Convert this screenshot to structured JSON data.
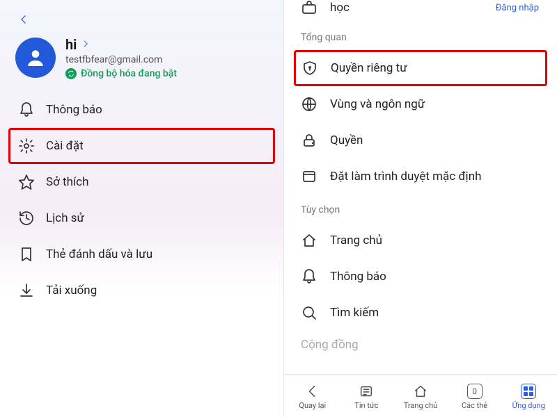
{
  "left": {
    "profile": {
      "name": "hi",
      "email": "testfbfear@gmail.com",
      "sync_status": "Đồng bộ hóa đang bật"
    },
    "menu": [
      {
        "label": "Thông báo",
        "icon": "bell"
      },
      {
        "label": "Cài đặt",
        "icon": "gear",
        "highlighted": true
      },
      {
        "label": "Sở thích",
        "icon": "star"
      },
      {
        "label": "Lịch sử",
        "icon": "history"
      },
      {
        "label": "Thẻ đánh dấu và lưu",
        "icon": "bookmark"
      },
      {
        "label": "Tải xuống",
        "icon": "download"
      }
    ]
  },
  "right": {
    "top_partial_label": "học",
    "signin_label": "Đăng nhập",
    "section_overview": "Tổng quan",
    "section_options": "Tùy chọn",
    "overview_items": [
      {
        "label": "Quyền riêng tư",
        "icon": "shield",
        "highlighted": true
      },
      {
        "label": "Vùng và ngôn ngữ",
        "icon": "globe"
      },
      {
        "label": "Quyền",
        "icon": "lock"
      },
      {
        "label": "Đặt làm trình duyệt mặc định",
        "icon": "window"
      }
    ],
    "option_items": [
      {
        "label": "Trang chủ",
        "icon": "home"
      },
      {
        "label": "Thông báo",
        "icon": "bell"
      },
      {
        "label": "Tìm kiếm",
        "icon": "search"
      }
    ],
    "bottom_partial": "Cộng đồng"
  },
  "bottom_nav": {
    "items": [
      {
        "label": "Quay lại",
        "icon": "chevron-left"
      },
      {
        "label": "Tin tức",
        "icon": "news"
      },
      {
        "label": "Trang chủ",
        "icon": "home"
      },
      {
        "label": "Các thẻ",
        "icon": "tabs",
        "count": "0"
      },
      {
        "label": "Ứng dụng",
        "icon": "apps",
        "active": true
      }
    ]
  }
}
